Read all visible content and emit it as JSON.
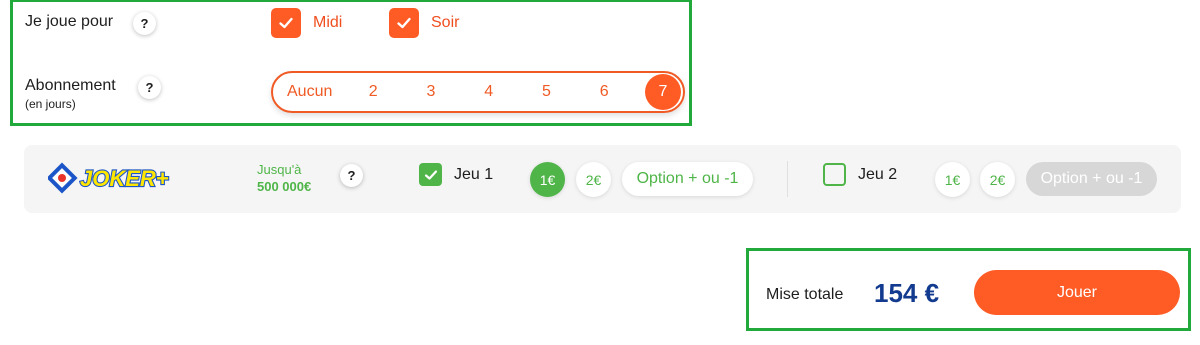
{
  "play_for": {
    "label": "Je joue pour",
    "help": "?",
    "options": [
      {
        "label": "Midi",
        "checked": true
      },
      {
        "label": "Soir",
        "checked": true
      }
    ]
  },
  "subscription": {
    "label": "Abonnement",
    "sublabel": "(en jours)",
    "help": "?",
    "options": [
      "Aucun",
      "2",
      "3",
      "4",
      "5",
      "6",
      "7"
    ],
    "selected": "7"
  },
  "joker": {
    "logo_text": "JOKER+",
    "jackpot_prefix": "Jusqu'à",
    "jackpot_amount": "500 000€",
    "help": "?",
    "games": [
      {
        "label": "Jeu 1",
        "checked": true,
        "coins": [
          "1€",
          "2€"
        ],
        "selected_coin": "1€",
        "option": "Option + ou -1",
        "option_enabled": true
      },
      {
        "label": "Jeu 2",
        "checked": false,
        "coins": [
          "1€",
          "2€"
        ],
        "selected_coin": null,
        "option": "Option + ou -1",
        "option_enabled": false
      }
    ]
  },
  "total": {
    "label": "Mise totale",
    "value": "154 €",
    "play_button": "Jouer"
  },
  "colors": {
    "orange": "#ff5b25",
    "green": "#4fb548",
    "frame_green": "#22a93b",
    "navy": "#123a8f"
  }
}
